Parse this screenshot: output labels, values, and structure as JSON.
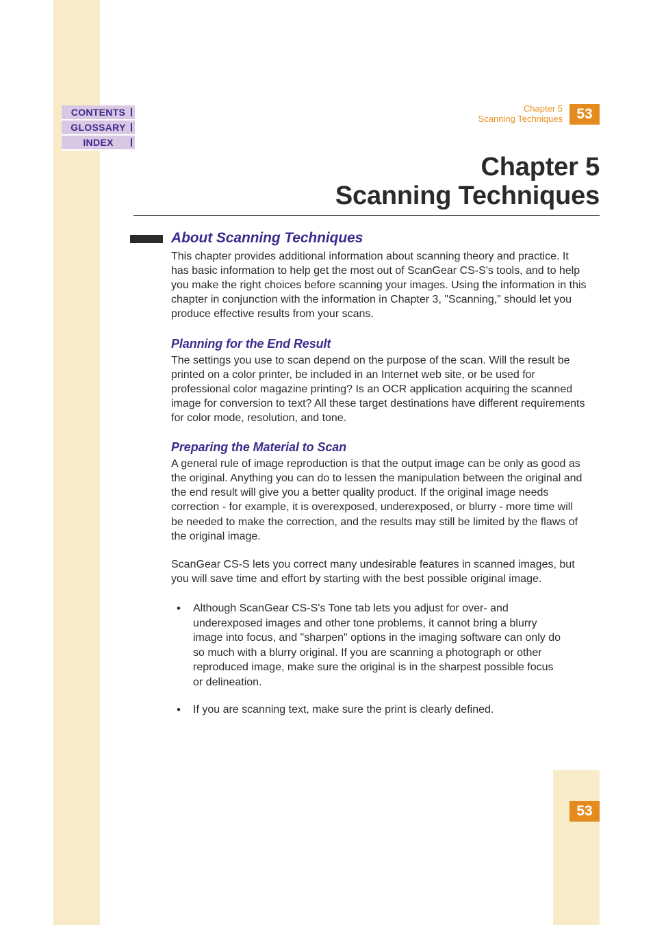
{
  "nav": {
    "contents": "CONTENTS",
    "glossary": "GLOSSARY",
    "index": "INDEX"
  },
  "header": {
    "chapter_label": "Chapter 5",
    "chapter_title": "Scanning Techniques",
    "page_number": "53"
  },
  "main_heading": {
    "line1": "Chapter 5",
    "line2": "Scanning Techniques"
  },
  "sections": {
    "about": {
      "heading": "About Scanning Techniques",
      "body": "This chapter provides additional information about scanning theory and practice. It has basic information to help get the most out of ScanGear CS-S's tools, and to help you make the right choices before scanning your images. Using the information in this chapter in conjunction with the information in Chapter 3, \"Scanning,\" should let you produce effective results from your scans."
    },
    "planning": {
      "heading": "Planning for the End Result",
      "body": "The settings you use to scan depend on the purpose of the scan. Will the result be printed on a color printer, be included in an Internet web site, or be used for professional color magazine printing? Is an OCR application acquiring the scanned image for conversion to text? All these target destinations have different requirements for color mode, resolution, and tone."
    },
    "preparing": {
      "heading": "Preparing the Material to Scan",
      "body1": "A general rule of image reproduction is that the output image can be only as good as the original. Anything you can do to lessen the manipulation between the original and the end result will give you a better quality product. If the original image needs correction - for example, it is overexposed, underexposed, or blurry - more time will be needed to make the correction, and the results may still be limited by the flaws of the original image.",
      "body2": "ScanGear CS-S lets you correct many undesirable features in scanned images, but you will save time and effort by starting with the best possible original image.",
      "bullets": [
        "Although ScanGear CS-S's Tone tab lets you adjust for over- and underexposed images and other tone problems, it cannot bring a blurry image into focus, and \"sharpen\" options in the imaging software can only do so much with a blurry original. If you are scanning a photograph or other reproduced image, make sure the original is in the sharpest possible focus or delineation.",
        "If you are scanning text, make sure the print is clearly defined."
      ]
    }
  },
  "footer": {
    "page_number": "53"
  }
}
